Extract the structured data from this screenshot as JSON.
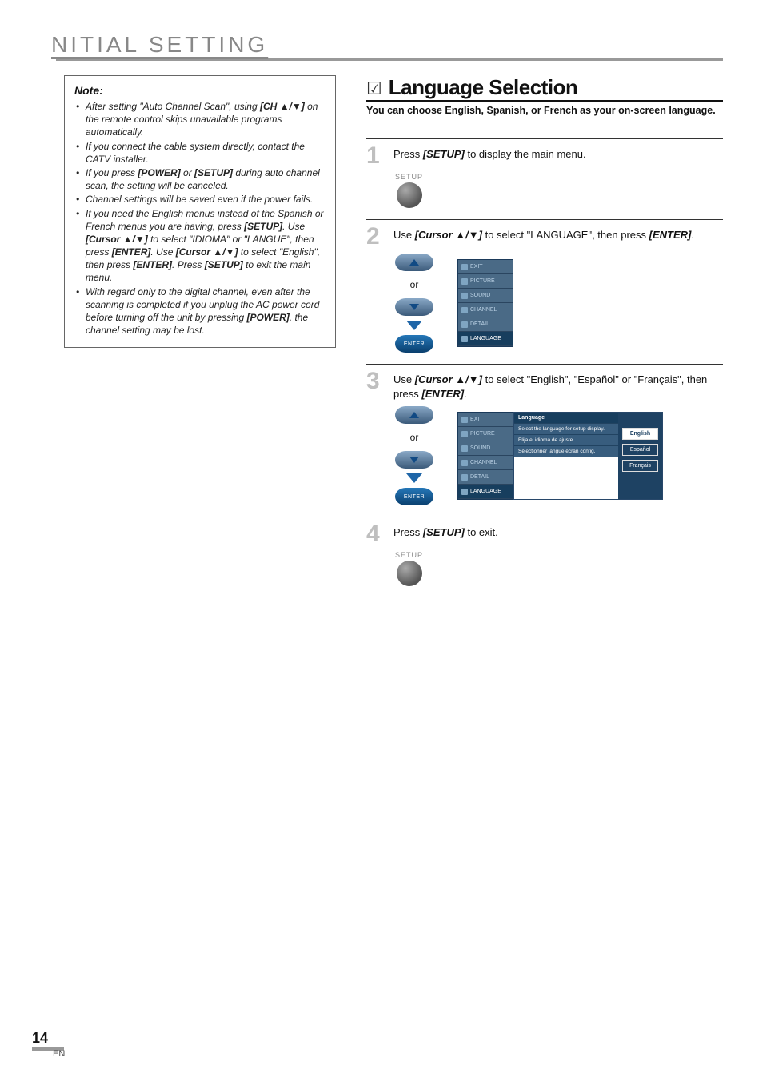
{
  "header": {
    "title": "NITIAL  SETTING"
  },
  "note": {
    "heading": "Note:",
    "items": [
      "After setting \"Auto Channel Scan\", using <b>[CH ▲/▼]</b> on the remote control skips unavailable programs automatically.",
      "If you connect the cable system directly, contact the CATV installer.",
      "If you press <b>[POWER]</b> or <b>[SETUP]</b> during auto channel scan, the setting will be canceled.",
      "Channel settings will be saved even if the power fails.",
      "If you need the English menus instead of the Spanish or French menus you are having, press <b>[SETUP]</b>. Use <b>[Cursor ▲/▼]</b> to select \"IDIOMA\" or \"LANGUE\", then press <b>[ENTER]</b>. Use <b>[Cursor ▲/▼]</b> to select \"English\", then press <b>[ENTER]</b>. Press <b>[SETUP]</b> to exit the main menu.",
      "With regard only to the digital channel, even after the scanning is completed if you unplug the AC power cord before turning off the unit by pressing <b>[POWER]</b>, the channel setting may be lost."
    ]
  },
  "section": {
    "check": "☑",
    "title": "Language Selection",
    "subtitle": "You can choose English, Spanish, or French as your on-screen language."
  },
  "steps": [
    {
      "num": "1",
      "text": "Press <b>[SETUP]</b> to display the main menu."
    },
    {
      "num": "2",
      "text": "Use <b>[Cursor ▲/▼]</b> to select \"LANGUAGE\", then press <b>[ENTER]</b>."
    },
    {
      "num": "3",
      "text": "Use <b>[Cursor ▲/▼]</b> to select \"English\", \"Español\" or \"Français\", then press <b>[ENTER]</b>."
    },
    {
      "num": "4",
      "text": "Press <b>[SETUP]</b> to exit."
    }
  ],
  "remote": {
    "setup_label": "SETUP",
    "or": "or",
    "enter": "ENTER"
  },
  "menu_items": [
    "EXIT",
    "PICTURE",
    "SOUND",
    "CHANNEL",
    "DETAIL",
    "LANGUAGE"
  ],
  "lang_panel": {
    "heading": "Language",
    "rows": [
      "Select the language for setup display.",
      "Elija el idioma de ajuste.",
      "Sélectionner langue écran config."
    ],
    "options": [
      "English",
      "Español",
      "Français"
    ]
  },
  "footer": {
    "page": "14",
    "lang": "EN"
  }
}
